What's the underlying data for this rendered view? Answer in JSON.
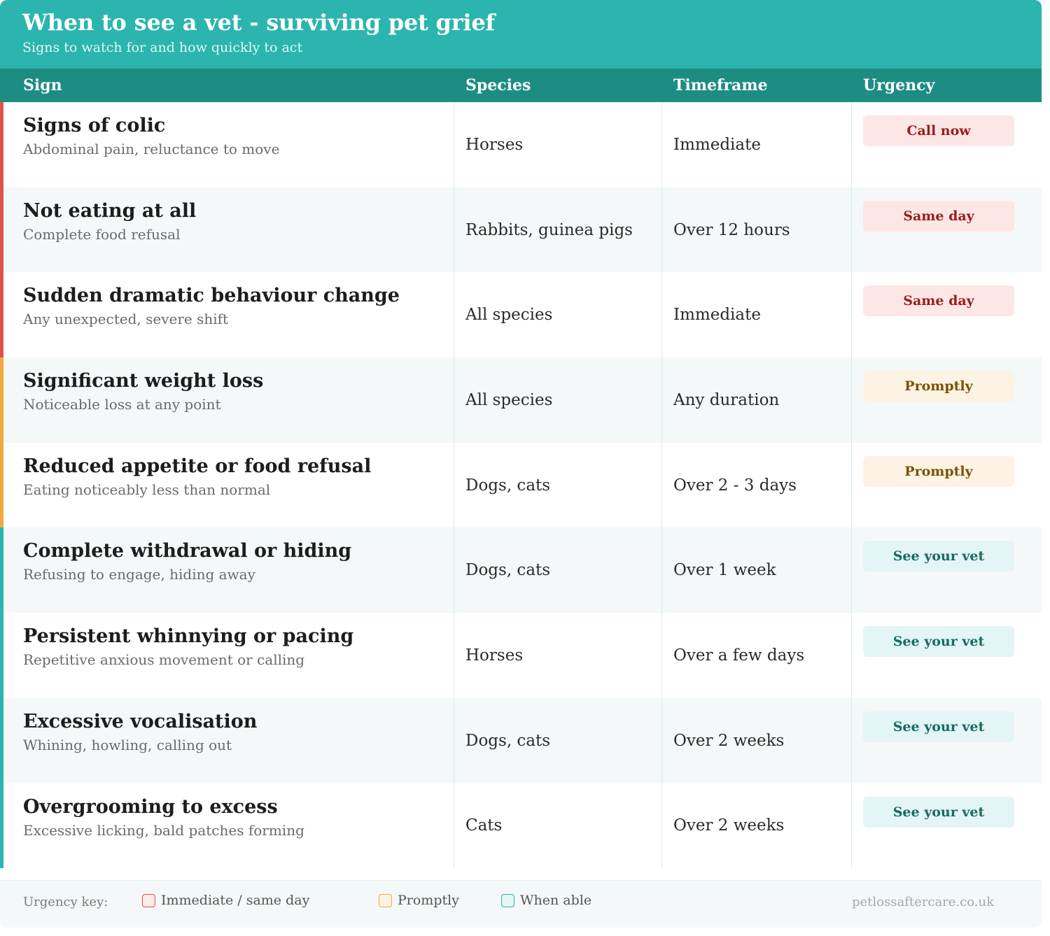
{
  "header": {
    "title": "When to see a vet - surviving pet grief",
    "subtitle": "Signs to watch for and how quickly to act"
  },
  "columns": {
    "sign": "Sign",
    "species": "Species",
    "timeframe": "Timeframe",
    "urgency": "Urgency"
  },
  "colors": {
    "header_bg": "#2bb5ae",
    "thead_bg": "#1d8d84",
    "immediate_bar": "#e0524a",
    "promptly_bar": "#f0a93a",
    "when_able_bar": "#2bb5ae"
  },
  "rows": [
    {
      "sign": "Signs of colic",
      "desc": "Abdominal pain, reluctance to move",
      "species": "Horses",
      "timeframe": "Immediate",
      "urgency": "Call now",
      "level": "red"
    },
    {
      "sign": "Not eating at all",
      "desc": "Complete food refusal",
      "species": "Rabbits, guinea pigs",
      "timeframe": "Over 12 hours",
      "urgency": "Same day",
      "level": "red"
    },
    {
      "sign": "Sudden dramatic behaviour change",
      "desc": "Any unexpected, severe shift",
      "species": "All species",
      "timeframe": "Immediate",
      "urgency": "Same day",
      "level": "red"
    },
    {
      "sign": "Significant weight loss",
      "desc": "Noticeable loss at any point",
      "species": "All species",
      "timeframe": "Any duration",
      "urgency": "Promptly",
      "level": "orange"
    },
    {
      "sign": "Reduced appetite or food refusal",
      "desc": "Eating noticeably less than normal",
      "species": "Dogs, cats",
      "timeframe": "Over 2 - 3 days",
      "urgency": "Promptly",
      "level": "orange"
    },
    {
      "sign": "Complete withdrawal or hiding",
      "desc": "Refusing to engage, hiding away",
      "species": "Dogs, cats",
      "timeframe": "Over 1 week",
      "urgency": "See your vet",
      "level": "teal"
    },
    {
      "sign": "Persistent whinnying or pacing",
      "desc": "Repetitive anxious movement or calling",
      "species": "Horses",
      "timeframe": "Over a few days",
      "urgency": "See your vet",
      "level": "teal"
    },
    {
      "sign": "Excessive vocalisation",
      "desc": "Whining, howling, calling out",
      "species": "Dogs, cats",
      "timeframe": "Over 2 weeks",
      "urgency": "See your vet",
      "level": "teal"
    },
    {
      "sign": "Overgrooming to excess",
      "desc": "Excessive licking, bald patches forming",
      "species": "Cats",
      "timeframe": "Over 2 weeks",
      "urgency": "See your vet",
      "level": "teal"
    }
  ],
  "footer": {
    "key_label": "Urgency key:",
    "key_items": [
      {
        "label": "Immediate / same day",
        "level": "red"
      },
      {
        "label": "Promptly",
        "level": "orange"
      },
      {
        "label": "When able",
        "level": "teal"
      }
    ],
    "site": "petlossaftercare.co.uk"
  }
}
